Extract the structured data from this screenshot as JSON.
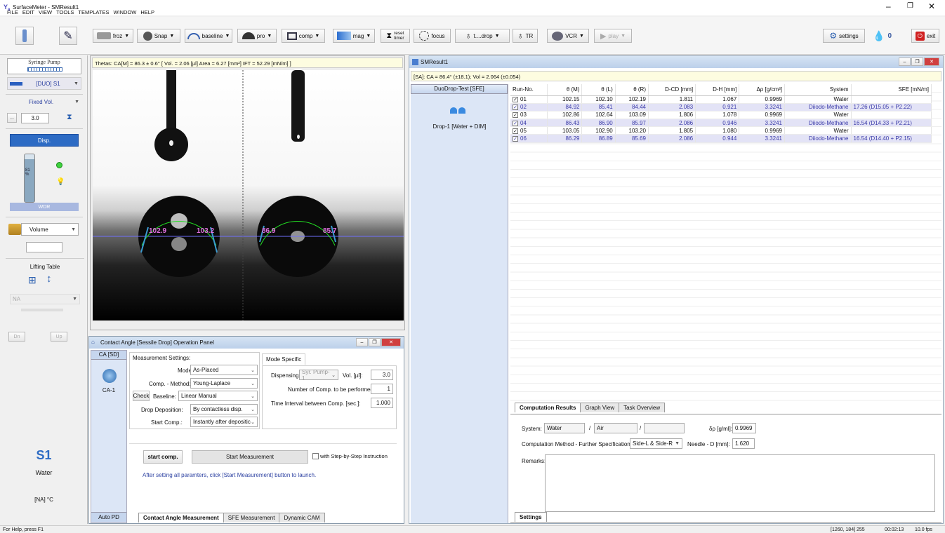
{
  "window": {
    "title": "SurfaceMeter - SMResult1"
  },
  "menu": [
    "FILE",
    "EDIT",
    "VIEW",
    "TOOLS",
    "TEMPLATES",
    "WINDOW",
    "HELP"
  ],
  "toolbar": {
    "froz": "froz",
    "snap": "Snap",
    "baseline": "baseline",
    "pro": "pro",
    "comp": "comp",
    "mag": "mag",
    "reset": "reset",
    "timer": "timer",
    "focus": "focus",
    "tdrop": "t....drop",
    "tr": "TR",
    "vcr": "VCR",
    "play": "play",
    "settings": "settings",
    "badge": "0",
    "exit": "exit"
  },
  "left": {
    "syringe_title": "Syringe Pump",
    "pump": "[DUO] S1",
    "mode": "Fixed Vol.",
    "ellipsis": "...",
    "volume": "3.0",
    "disp": "Disp.",
    "syr_level": "81\n%",
    "wdr": "WDR",
    "volume_sel": "Volume",
    "lifting": "Lifting Table",
    "na": "NA",
    "dn": "Dn",
    "up": "Up",
    "s1": "S1",
    "liquid": "Water",
    "temp": "[NA] °C"
  },
  "image": {
    "status": "Thetas: CA[M] = 86.3 ± 0.6° [ Vol. = 2.06 [µl]  Area = 6.27 [mm²] IFT = 52.29 [mN/m] ]",
    "a1": "102.9",
    "a2": "103.2",
    "a3": "86.9",
    "a4": "85.7"
  },
  "result": {
    "title": "SMResult1",
    "summary": "[SA]: CA = 86.4° (±18.1); Vol = 2.064 (±0.054)",
    "test": "DuoDrop-Test [SFE]",
    "drop": "Drop-1 [Water + DIM]",
    "headers": [
      "Run-No.",
      "θ (M)",
      "θ (L)",
      "θ (R)",
      "D-CD [mm]",
      "D-H [mm]",
      "Δρ [g/cm³]",
      "System",
      "SFE [mN/m]"
    ],
    "rows": [
      [
        "01",
        "102.15",
        "102.10",
        "102.19",
        "1.811",
        "1.067",
        "0.9969",
        "Water",
        ""
      ],
      [
        "02",
        "84.92",
        "85.41",
        "84.44",
        "2.083",
        "0.921",
        "3.3241",
        "Diiodo-Methane",
        "17.26 (D15.05 + P2.22)"
      ],
      [
        "03",
        "102.86",
        "102.64",
        "103.09",
        "1.806",
        "1.078",
        "0.9969",
        "Water",
        ""
      ],
      [
        "04",
        "86.43",
        "86.90",
        "85.97",
        "2.086",
        "0.946",
        "3.3241",
        "Diiodo-Methane",
        "16.54 (D14.33 + P2.21)"
      ],
      [
        "05",
        "103.05",
        "102.90",
        "103.20",
        "1.805",
        "1.080",
        "0.9969",
        "Water",
        ""
      ],
      [
        "06",
        "86.29",
        "86.89",
        "85.69",
        "2.086",
        "0.944",
        "3.3241",
        "Diiodo-Methane",
        "16.54 (D14.40 + P2.15)"
      ]
    ],
    "tabs": [
      "Computation Results",
      "Graph View",
      "Task Overview"
    ],
    "system_lbl": "System:",
    "sys1": "Water",
    "slash": "/",
    "sys2": "Air",
    "sys3": "",
    "dr_lbl": "δρ [g/ml]:",
    "dr": "0.9969",
    "method_lbl": "Computation Method - Further Specification:",
    "method": "Side-L & Side-R",
    "needle_lbl": "Needle - D [mm]:",
    "needle": "1.620",
    "remarks": "Remarks:",
    "settings_tab": "Settings"
  },
  "panel": {
    "title": "Contact Angle [Sessile Drop] Operation Panel",
    "side_top": "CA [SD]",
    "ca1": "CA-1",
    "side_bottom": "Auto PD",
    "ms": "Measurement Settings:",
    "mode_lbl": "Mode:",
    "mode": "As-Placed",
    "cm_lbl": "Comp. - Method:",
    "cm": "Young-Laplace",
    "check": "Check",
    "bl_lbl": "Baseline:",
    "bl": "Linear Manual",
    "dd_lbl": "Drop Deposition:",
    "dd": "By contactless disp.",
    "sc_lbl": "Start Comp.:",
    "sc": "Instantly after depositic",
    "ms_tab": "Mode Specific",
    "disp_lbl": "Dispensing:",
    "disp": "Syr. Pump-1",
    "vol_lbl": "Vol. [µl]:",
    "vol": "3.0",
    "num_lbl": "Number of Comp. to be performed:",
    "num": "1",
    "ti_lbl": "Time Interval between Comp. [sec.]:",
    "ti": "1.000",
    "start_comp": "start comp.",
    "start_meas": "Start Measurement",
    "step": "with Step-by-Step Instruction",
    "hint": "After setting all paramters, click [Start Measurement] button to launch.",
    "tabs": [
      "Contact Angle Measurement",
      "SFE Measurement",
      "Dynamic CAM"
    ]
  },
  "status": {
    "help": "For Help, press F1",
    "coords": "[1260, 184] 255",
    "time": "00:02:13",
    "fps": "10.0 fps"
  }
}
